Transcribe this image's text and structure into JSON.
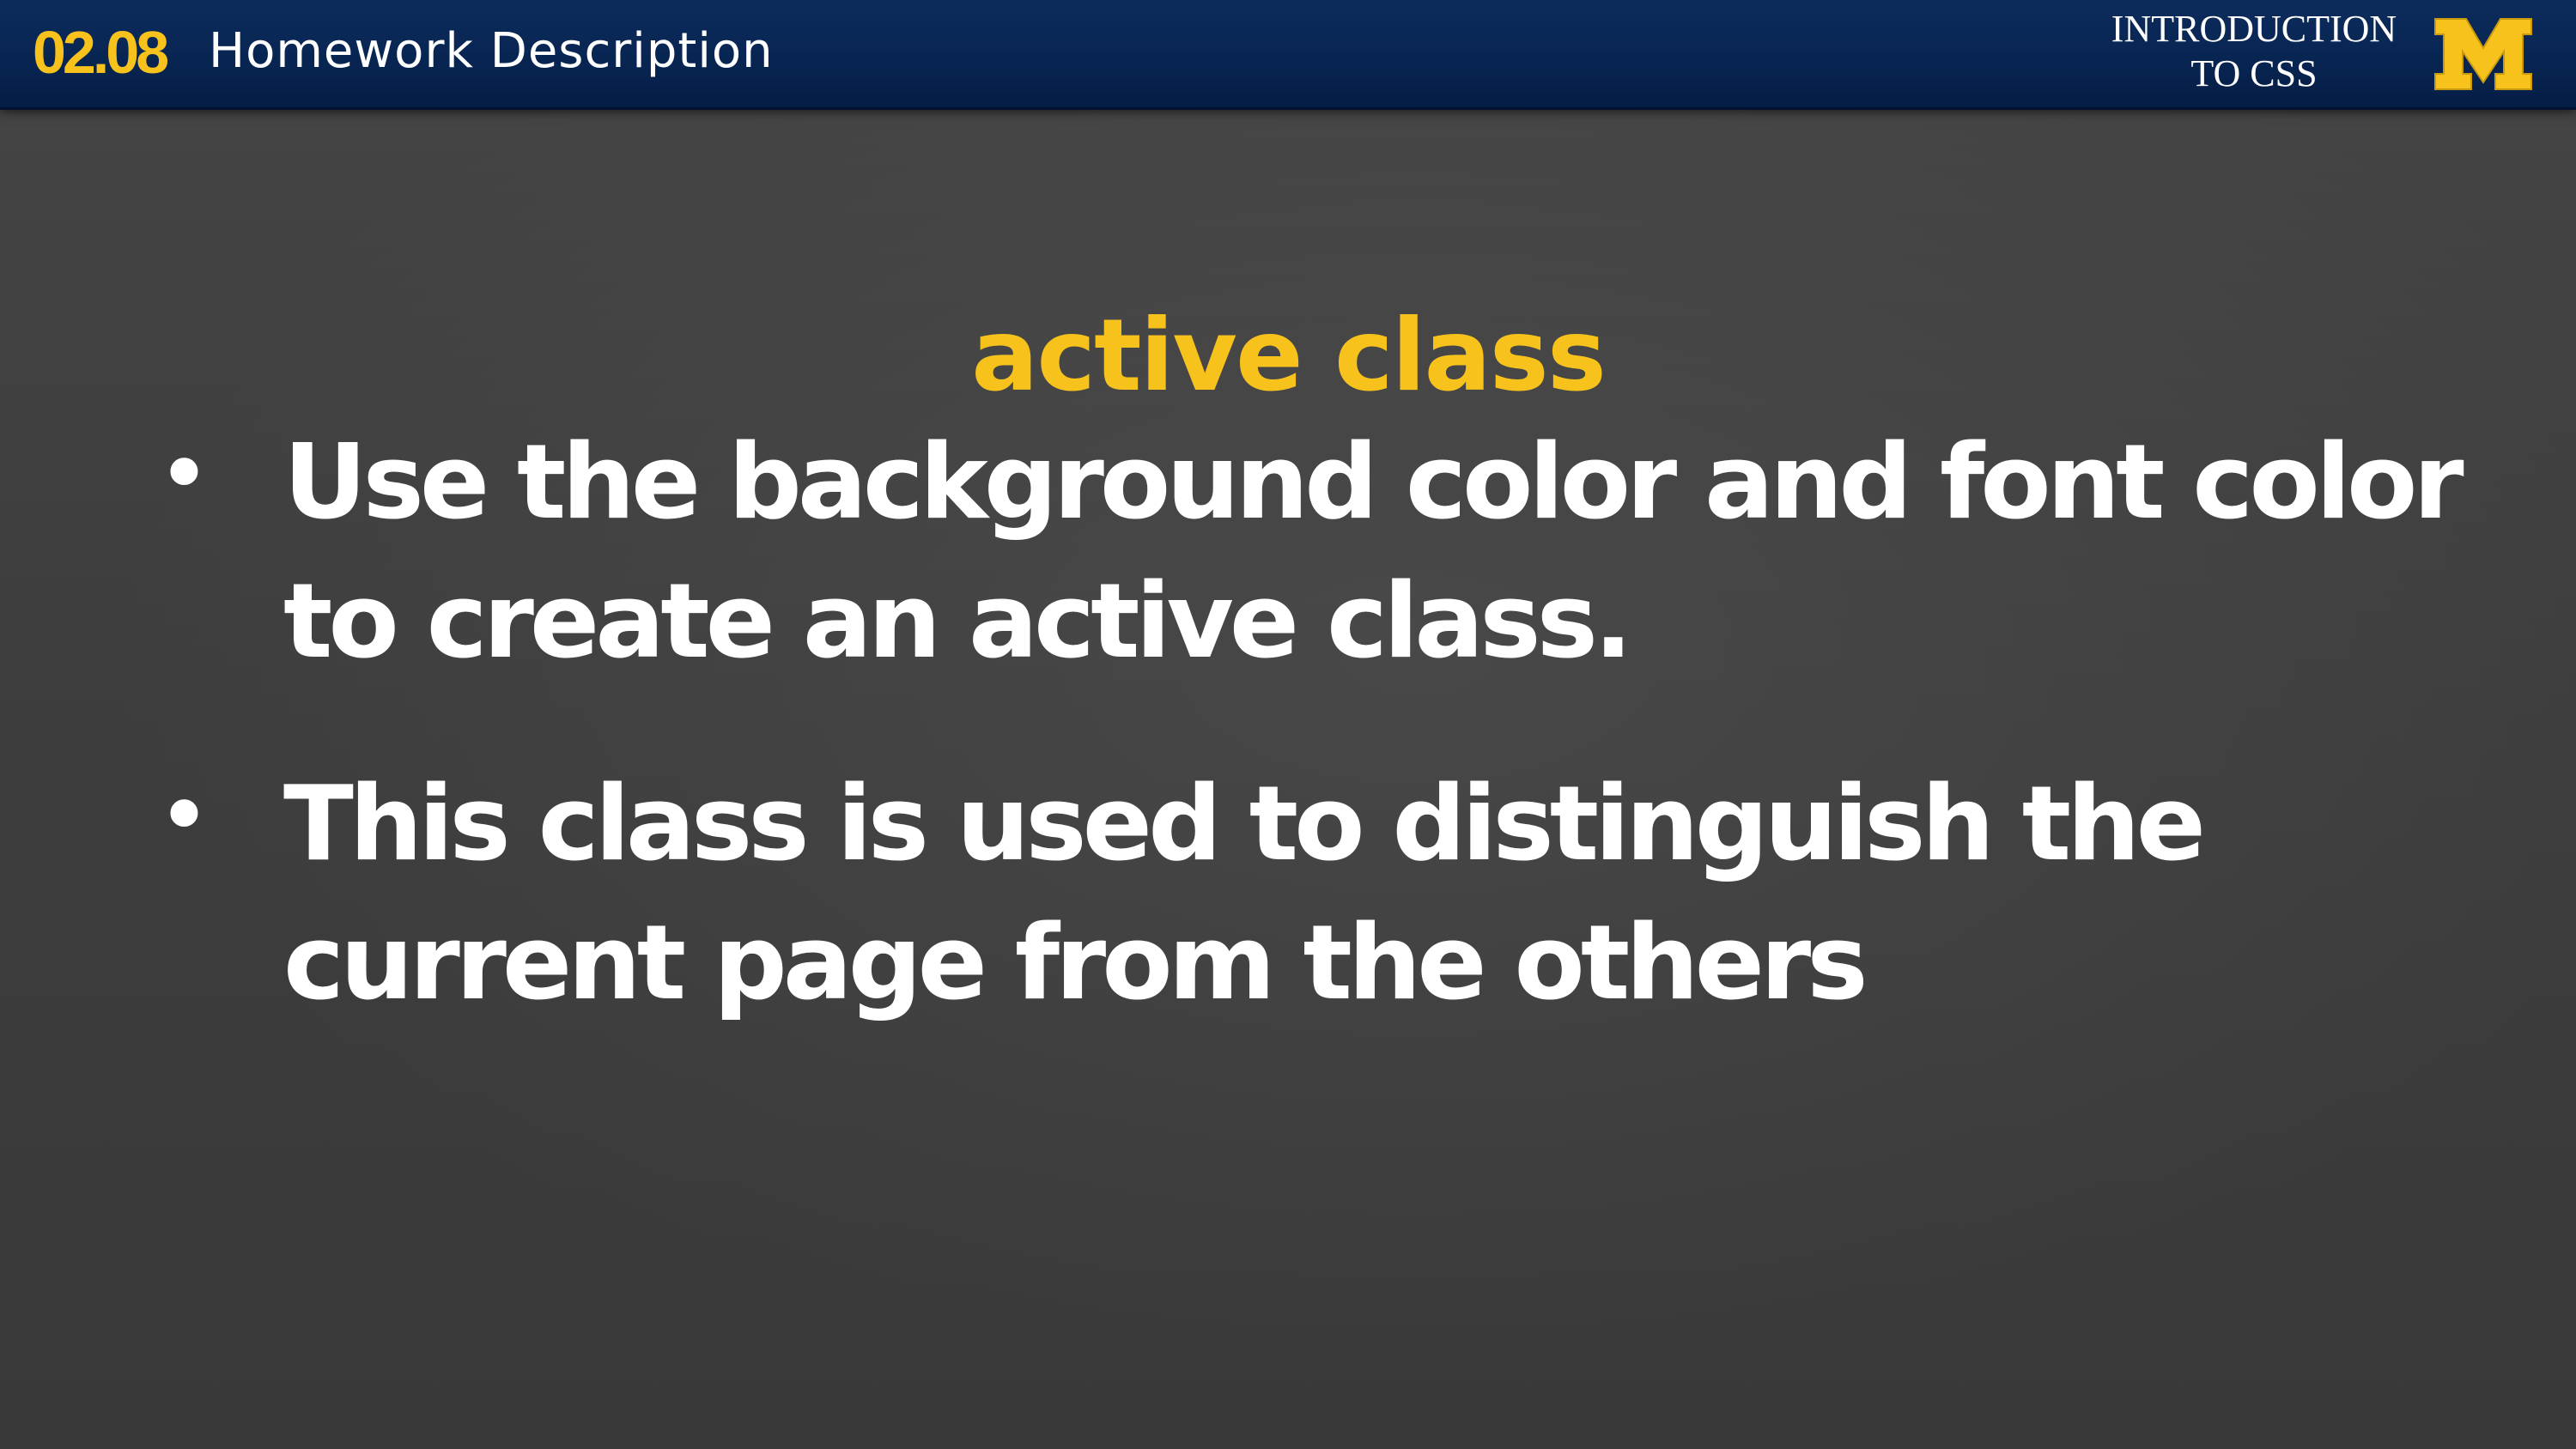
{
  "header": {
    "lesson_number": "02.08",
    "lesson_title": "Homework Description",
    "course_title_line1": "INTRODUCTION",
    "course_title_line2": "TO CSS",
    "logo_letter": "M",
    "logo_icon": "block-m-logo"
  },
  "slide": {
    "heading": "active class",
    "bullets": [
      {
        "text": "Use the background color and font color to create an active class."
      },
      {
        "text": "This class is used to distinguish the current page from the others"
      }
    ]
  },
  "colors": {
    "header_background": "#082552",
    "accent_maize": "#f7c21c",
    "slide_background": "#3f3f3f",
    "body_text": "#ffffff"
  }
}
